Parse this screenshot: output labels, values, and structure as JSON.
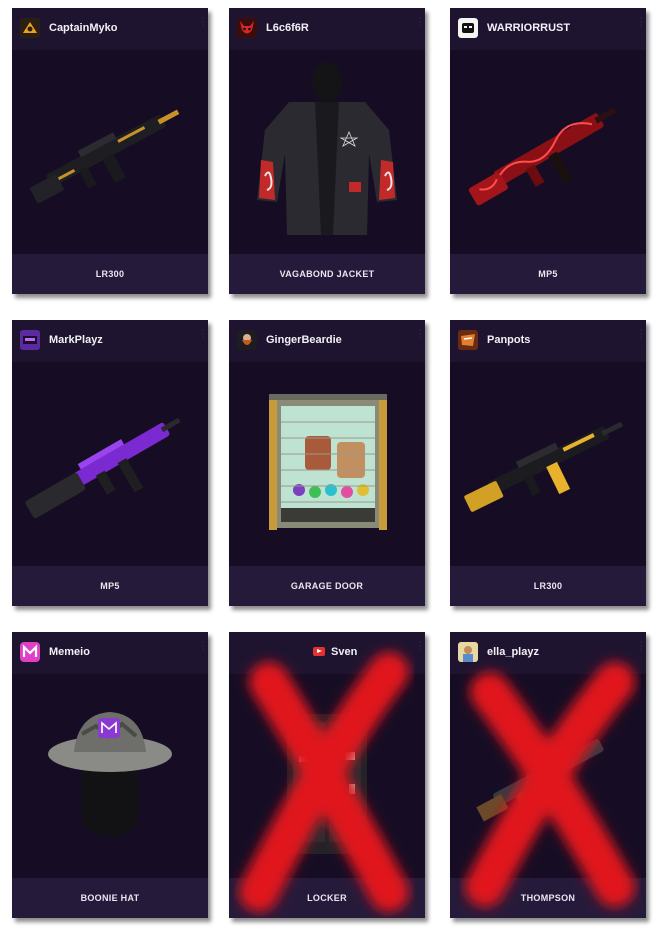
{
  "colors": {
    "card_bg": "#1a1028",
    "card_header": "#1e1430",
    "card_footer": "#261a3a",
    "page_bg": "#ffffff",
    "cross_red": "#e0141e"
  },
  "cards": [
    {
      "creator": "CaptainMyko",
      "item": "LR300",
      "avatar_icon": "captainmyko-avatar",
      "art_icon": "rifle-black-gold-icon"
    },
    {
      "creator": "L6c6f6R",
      "item": "VAGABOND JACKET",
      "avatar_icon": "devil-mask-avatar",
      "art_icon": "jacket-icon"
    },
    {
      "creator": "WARRIORRUST",
      "item": "MP5",
      "avatar_icon": "warriorrust-avatar",
      "art_icon": "smg-red-icon"
    },
    {
      "creator": "MarkPlayz",
      "item": "MP5",
      "avatar_icon": "markplayz-avatar",
      "art_icon": "smg-purple-icon"
    },
    {
      "creator": "GingerBeardie",
      "item": "GARAGE DOOR",
      "avatar_icon": "gingerbeardie-avatar",
      "art_icon": "garage-door-icon"
    },
    {
      "creator": "Panpots",
      "item": "LR300",
      "avatar_icon": "panpots-avatar",
      "art_icon": "rifle-yellow-icon"
    },
    {
      "creator": "Memeio",
      "item": "BOONIE HAT",
      "avatar_icon": "memeio-avatar",
      "art_icon": "boonie-hat-icon"
    },
    {
      "creator": "Sven",
      "item": "LOCKER",
      "avatar_icon": "youtube-icon",
      "art_icon": "locker-icon"
    },
    {
      "creator": "ella_playz",
      "item": "THOMPSON",
      "avatar_icon": "ella-playz-avatar",
      "art_icon": "thompson-icon"
    }
  ]
}
